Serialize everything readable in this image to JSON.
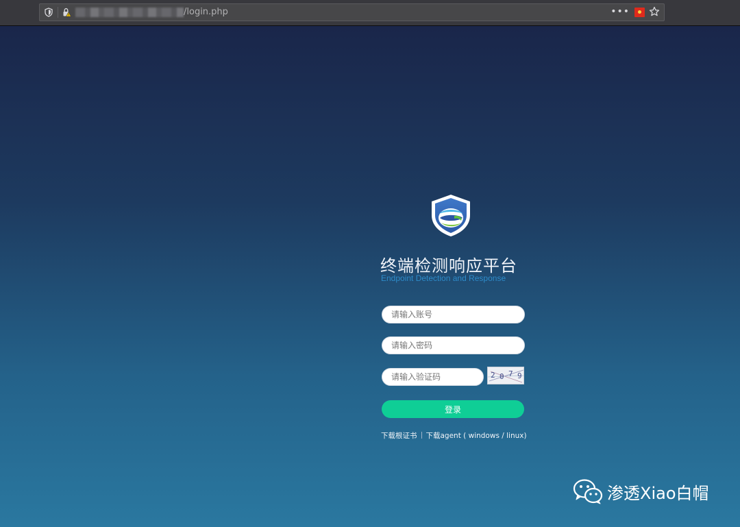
{
  "browser": {
    "url_suffix": "/login.php",
    "more_icon": "ellipsis-icon",
    "flag_icon": "china-flag-icon",
    "bookmark_icon": "star-icon"
  },
  "login": {
    "title_cn": "终端检测响应平台",
    "title_en": "Endpoint Detection and Response",
    "username_placeholder": "请输入账号",
    "password_placeholder": "请输入密码",
    "captcha_placeholder": "请输入验证码",
    "captcha_chars": [
      "2",
      "0",
      "7",
      "9"
    ],
    "login_label": "登录",
    "link_cert": "下载根证书",
    "link_agent": "下载agent ( windows / linux)"
  },
  "watermark": {
    "text": "渗透Xiao白帽"
  },
  "colors": {
    "bg_top": "#1a264a",
    "bg_bottom": "#2a78a0",
    "login_button": "#0fce96",
    "title_en": "#2d8bc9"
  }
}
